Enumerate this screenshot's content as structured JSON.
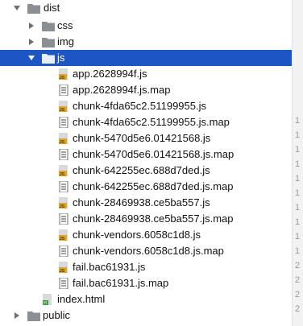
{
  "tree": {
    "dist_label": "dist",
    "css_label": "css",
    "img_label": "img",
    "js_label": "js",
    "files": [
      {
        "name": "app.2628994f.js",
        "type": "js"
      },
      {
        "name": "app.2628994f.js.map",
        "type": "map"
      },
      {
        "name": "chunk-4fda65c2.51199955.js",
        "type": "js"
      },
      {
        "name": "chunk-4fda65c2.51199955.js.map",
        "type": "map"
      },
      {
        "name": "chunk-5470d5e6.01421568.js",
        "type": "js"
      },
      {
        "name": "chunk-5470d5e6.01421568.js.map",
        "type": "map"
      },
      {
        "name": "chunk-642255ec.688d7ded.js",
        "type": "js"
      },
      {
        "name": "chunk-642255ec.688d7ded.js.map",
        "type": "map"
      },
      {
        "name": "chunk-28469938.ce5ba557.js",
        "type": "js"
      },
      {
        "name": "chunk-28469938.ce5ba557.js.map",
        "type": "map"
      },
      {
        "name": "chunk-vendors.6058c1d8.js",
        "type": "js"
      },
      {
        "name": "chunk-vendors.6058c1d8.js.map",
        "type": "map"
      },
      {
        "name": "fail.bac61931.js",
        "type": "js"
      },
      {
        "name": "fail.bac61931.js.map",
        "type": "map"
      }
    ],
    "index_label": "index.html",
    "public_label": "public"
  },
  "gutter": [
    "1",
    "1",
    "1",
    "1",
    "1",
    "1",
    "1",
    "1",
    "1",
    "1",
    "2",
    "2",
    "2",
    "2"
  ],
  "icons": {
    "folder": "folder-icon",
    "folder_selected": "folder-open-icon",
    "js_file": "js-file-icon",
    "map_file": "map-file-icon",
    "html_file": "html-file-icon",
    "arrow_down": "chevron-down-icon",
    "arrow_right": "chevron-right-icon"
  },
  "colors": {
    "selection": "#1d55c4",
    "folder": "#8a8f96",
    "js_badge": "#e0a626",
    "html_badge": "#3f9c3f"
  }
}
